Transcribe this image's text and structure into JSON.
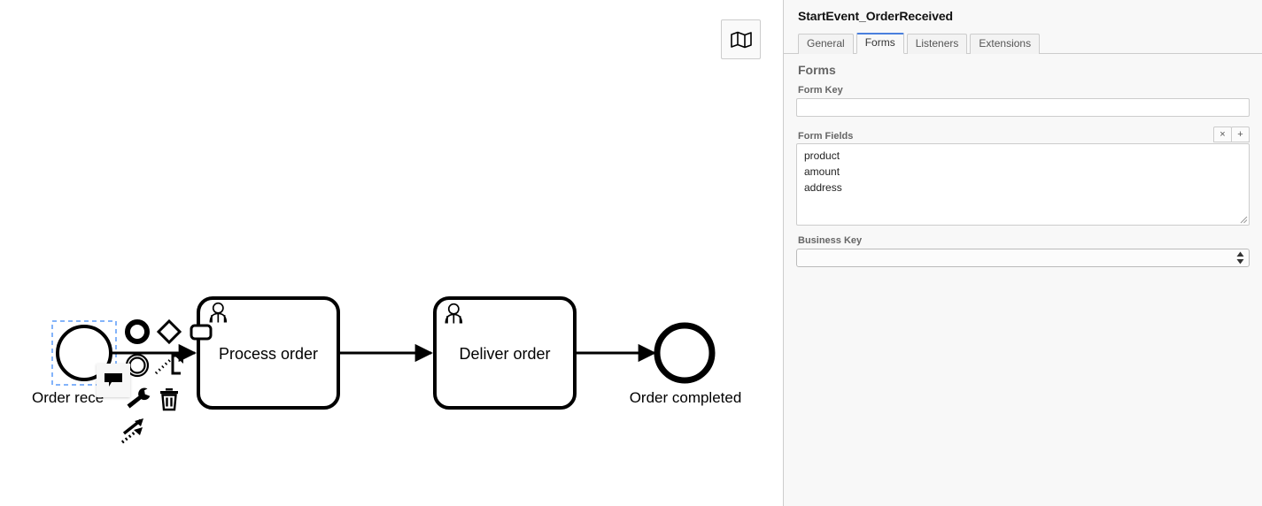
{
  "canvas": {
    "minimap_toggle_icon": "map-icon",
    "diagram": {
      "start_event": {
        "id": "StartEvent_OrderReceived",
        "label": "Order rece",
        "label_full": "Order received",
        "selected": true
      },
      "tasks": [
        {
          "label": "Process order",
          "type": "user-task"
        },
        {
          "label": "Deliver order",
          "type": "user-task"
        }
      ],
      "end_event": {
        "label": "Order completed"
      }
    },
    "context_pad": {
      "entries": [
        {
          "name": "append-end-event-icon",
          "glyph": "end-event"
        },
        {
          "name": "append-gateway-icon",
          "glyph": "gateway"
        },
        {
          "name": "append-task-icon",
          "glyph": "task"
        },
        {
          "name": "append-intermediate-event-icon",
          "glyph": "intermediate-event"
        },
        {
          "name": "append-text-annotation-icon",
          "glyph": "text-annotation"
        },
        {
          "name": "replace-wrench-icon",
          "glyph": "wrench"
        },
        {
          "name": "delete-trash-icon",
          "glyph": "trash"
        },
        {
          "name": "connect-arrows-icon",
          "glyph": "connect"
        }
      ],
      "popup": {
        "name": "annotation-bubble-icon",
        "glyph": "bubble"
      }
    }
  },
  "properties_panel": {
    "title": "StartEvent_OrderReceived",
    "tabs": [
      {
        "label": "General",
        "active": false
      },
      {
        "label": "Forms",
        "active": true
      },
      {
        "label": "Listeners",
        "active": false
      },
      {
        "label": "Extensions",
        "active": false
      }
    ],
    "group_title": "Forms",
    "form_key": {
      "label": "Form Key",
      "value": "",
      "placeholder": ""
    },
    "form_fields": {
      "label": "Form Fields",
      "remove_button": "×",
      "add_button": "+",
      "items": [
        "product",
        "amount",
        "address"
      ]
    },
    "business_key": {
      "label": "Business Key",
      "value": "",
      "options": [
        ""
      ]
    }
  },
  "colors": {
    "accent": "#4a7fdd",
    "selection": "#5b9bf8",
    "panel_bg": "#f8f8f8",
    "border": "#cccccc",
    "stroke": "#000000"
  }
}
